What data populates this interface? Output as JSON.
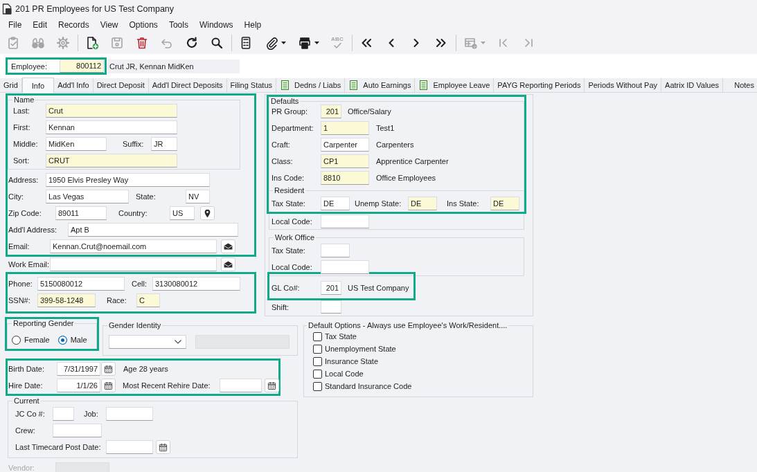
{
  "window": {
    "title": "201 PR Employees for US Test Company"
  },
  "menu": [
    "File",
    "Edit",
    "Records",
    "View",
    "Options",
    "Tools",
    "Windows",
    "Help"
  ],
  "toolbar": {
    "groups": [
      {
        "buttons": [
          {
            "disabled": true,
            "dropdown": false
          },
          {
            "disabled": true,
            "dropdown": false
          },
          {
            "disabled": true,
            "dropdown": false
          }
        ]
      },
      {
        "buttons": [
          {
            "disabled": false,
            "dropdown": false
          },
          {
            "disabled": true,
            "dropdown": false
          },
          {
            "disabled": false,
            "dropdown": false
          },
          {
            "disabled": true,
            "dropdown": false
          },
          {
            "disabled": false,
            "dropdown": false
          },
          {
            "disabled": false,
            "dropdown": false
          }
        ]
      },
      {
        "buttons": [
          {
            "disabled": false,
            "dropdown": false
          },
          {
            "disabled": false,
            "dropdown": true
          },
          {
            "disabled": false,
            "dropdown": true
          },
          {
            "disabled": true,
            "dropdown": false,
            "text": "ABC"
          }
        ]
      },
      {
        "buttons": [
          {
            "disabled": false,
            "dropdown": false
          },
          {
            "disabled": false,
            "dropdown": false
          },
          {
            "disabled": false,
            "dropdown": false
          },
          {
            "disabled": false,
            "dropdown": false
          }
        ]
      },
      {
        "buttons": [
          {
            "disabled": true,
            "dropdown": true
          },
          {
            "disabled": true,
            "dropdown": false
          },
          {
            "disabled": true,
            "dropdown": false
          }
        ]
      }
    ]
  },
  "employee": {
    "highlighted": true,
    "label": "Employee:",
    "value": "800112",
    "required": true,
    "name": "Crut JR, Kennan MidKen"
  },
  "tabs": [
    {
      "label": "Grid",
      "selected": false,
      "icon": false
    },
    {
      "label": "Info",
      "selected": true,
      "icon": false
    },
    {
      "label": "Add'l Info",
      "selected": false,
      "icon": false
    },
    {
      "label": "Direct Deposit",
      "selected": false,
      "icon": false
    },
    {
      "label": "Add'l Direct Deposits",
      "selected": false,
      "icon": false
    },
    {
      "label": "Filing Status",
      "selected": false,
      "icon": false
    },
    {
      "label": "Dedns / Liabs",
      "selected": false,
      "icon": true
    },
    {
      "label": "Auto Earnings",
      "selected": false,
      "icon": true
    },
    {
      "label": "Employee Leave",
      "selected": false,
      "icon": true
    },
    {
      "label": "PAYG Reporting Periods",
      "selected": false,
      "icon": false
    },
    {
      "label": "Periods Without Pay",
      "selected": false,
      "icon": false
    },
    {
      "label": "Aatrix ID Values",
      "selected": false,
      "icon": false
    },
    {
      "label": "Notes",
      "selected": false,
      "icon": false
    }
  ],
  "personal": {
    "highlighted": true,
    "name": {
      "legend": "Name",
      "last": {
        "label": "Last:",
        "value": "Crut",
        "required": true
      },
      "first": {
        "label": "First:",
        "value": "Kennan",
        "required": false
      },
      "middle": {
        "label": "Middle:",
        "value": "MidKen",
        "required": false
      },
      "suffix": {
        "label": "Suffix:",
        "value": "JR",
        "required": false
      },
      "sort": {
        "label": "Sort:",
        "value": "CRUT",
        "required": true
      }
    },
    "address": {
      "label": "Address:",
      "value": "1950 Elvis Presley Way",
      "required": false
    },
    "city": {
      "label": "City:",
      "value": "Las Vegas",
      "required": false
    },
    "state": {
      "label": "State:",
      "value": "NV",
      "required": false
    },
    "zip_code": {
      "label": "Zip Code:",
      "value": "89011",
      "required": false
    },
    "country": {
      "label": "Country:",
      "value": "US",
      "required": false
    },
    "addl_address": {
      "label": "Add'l Address:",
      "value": "Apt B",
      "required": false
    },
    "email": {
      "label": "Email:",
      "value": "Kennan.Crut@noemail.com",
      "required": false
    }
  },
  "work_email": {
    "label": "Work Email:",
    "required": false
  },
  "contact": {
    "highlighted": true,
    "phone": {
      "label": "Phone:",
      "value": "5150080012",
      "required": false
    },
    "cell": {
      "label": "Cell:",
      "value": "3130080012",
      "required": false
    },
    "ssn": {
      "label": "SSN#:",
      "value": "399-58-1248",
      "required": true
    },
    "race": {
      "label": "Race:",
      "value": "C",
      "required": true
    }
  },
  "defaults": {
    "highlighted": true,
    "legend": "Defaults",
    "pr_group": {
      "label": "PR Group:",
      "value": "201",
      "required": true,
      "description": "Office/Salary"
    },
    "department": {
      "label": "Department:",
      "value": "1",
      "required": true,
      "description": "Test1"
    },
    "craft": {
      "label": "Craft:",
      "value": "Carpenter",
      "required": false,
      "description": "Carpenters"
    },
    "class": {
      "label": "Class:",
      "value": "CP1",
      "required": true,
      "description": "Apprentice Carpenter"
    },
    "ins_code": {
      "label": "Ins Code:",
      "value": "8810",
      "required": true,
      "description": "Office Employees"
    },
    "resident": {
      "legend": "Resident",
      "tax_state": {
        "label": "Tax State:",
        "value": "DE",
        "required": false
      },
      "unemp_state": {
        "label": "Unemp State:",
        "value": "DE",
        "required": true
      },
      "ins_state": {
        "label": "Ins State:",
        "value": "DE",
        "required": true
      },
      "local_code": {
        "label": "Local Code:",
        "required": false
      }
    }
  },
  "work_office": {
    "legend": "Work Office",
    "tax_state": {
      "label": "Tax State:",
      "required": false
    },
    "local_code": {
      "label": "Local Code:",
      "required": false
    }
  },
  "gl_company": {
    "highlighted": true,
    "label": "GL Co#:",
    "value": "201",
    "required": false,
    "description": "US Test Company"
  },
  "shift": {
    "label": "Shift:",
    "required": false
  },
  "reporting_gender": {
    "highlighted": true,
    "legend": "Reporting Gender",
    "options": [
      {
        "label": "Female",
        "selected": false
      },
      {
        "label": "Male",
        "selected": true
      }
    ]
  },
  "gender_identity": {
    "legend": "Gender Identity",
    "description_field": {
      "disabled": true
    }
  },
  "default_options": {
    "legend": "Default Options - Always use Employee's Work/Resident....",
    "options": [
      {
        "label": "Tax State",
        "checked": false
      },
      {
        "label": "Unemployment State",
        "checked": false
      },
      {
        "label": "Insurance State",
        "checked": false
      },
      {
        "label": "Local Code",
        "checked": false
      },
      {
        "label": "Standard Insurance Code",
        "checked": false
      }
    ]
  },
  "dates": {
    "highlighted": true,
    "birth_date": {
      "label": "Birth Date:",
      "value": "7/31/1997",
      "required": false
    },
    "age": "Age 28 years",
    "hire_date": {
      "label": "Hire Date:",
      "value": "1/1/26",
      "required": false
    },
    "rehire_date": {
      "label": "Most Recent Rehire Date:",
      "required": false
    }
  },
  "current": {
    "legend": "Current",
    "jc_co": {
      "label": "JC Co #:",
      "required": false
    },
    "job": {
      "label": "Job:",
      "required": false
    },
    "crew": {
      "label": "Crew:",
      "required": false
    },
    "last_timecard_post_date": {
      "label": "Last Timecard Post Date:",
      "required": false
    }
  },
  "vendor": {
    "label": "Vendor:",
    "disabled": true
  }
}
